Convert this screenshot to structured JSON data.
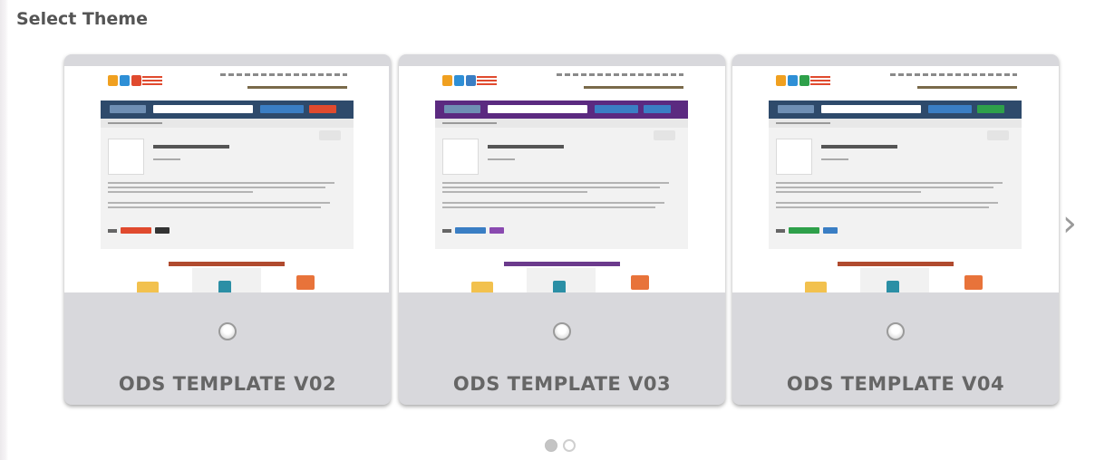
{
  "section": {
    "title": "Select Theme"
  },
  "carousel": {
    "next_icon": "chevron-right-icon",
    "next_glyph": "›",
    "page_count": 2,
    "active_page": 1,
    "templates": [
      {
        "label": "ODS TEMPLATE V02",
        "nav_color": "#2e4a6b",
        "accent": "#e04a2e",
        "tag1": "#e04a2e",
        "tag2": "#333333",
        "title_color": "#b04a2e",
        "selected": false
      },
      {
        "label": "ODS TEMPLATE V03",
        "nav_color": "#5b2a80",
        "accent": "#3a7ec4",
        "tag1": "#3a7ec4",
        "tag2": "#8a4ab0",
        "title_color": "#6b3a8c",
        "selected": false
      },
      {
        "label": "ODS TEMPLATE V04",
        "nav_color": "#2e4a6b",
        "accent": "#2ea04a",
        "tag1": "#2ea04a",
        "tag2": "#3a7ec4",
        "title_color": "#b04a2e",
        "selected": false
      }
    ]
  }
}
